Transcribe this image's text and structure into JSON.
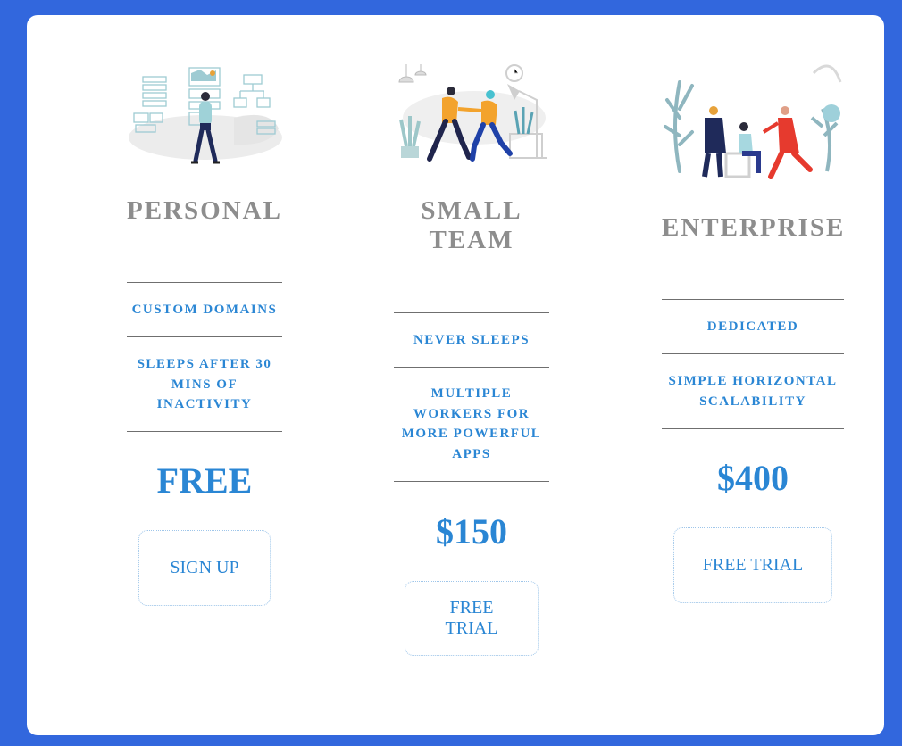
{
  "plans": [
    {
      "title": "PERSONAL",
      "features": [
        "CUSTOM DOMAINS",
        "SLEEPS AFTER 30 MINS OF INACTIVITY"
      ],
      "price": "FREE",
      "button": "SIGN UP",
      "illustration": "person-with-dashboard-illustration"
    },
    {
      "title": "SMALL TEAM",
      "features": [
        "NEVER SLEEPS",
        "MULTIPLE WORKERS FOR MORE POWERFUL APPS"
      ],
      "price": "$150",
      "button": "FREE TRIAL",
      "illustration": "team-walking-illustration"
    },
    {
      "title": "ENTERPRISE",
      "features": [
        "DEDICATED",
        "SIMPLE HORIZONTAL SCALABILITY"
      ],
      "price": "$400",
      "button": "FREE TRIAL",
      "illustration": "office-meeting-illustration"
    }
  ],
  "colors": {
    "background": "#3267dd",
    "card": "#ffffff",
    "title": "#8d8d8d",
    "accent": "#2a86d4",
    "divider": "#9fc6ea"
  }
}
